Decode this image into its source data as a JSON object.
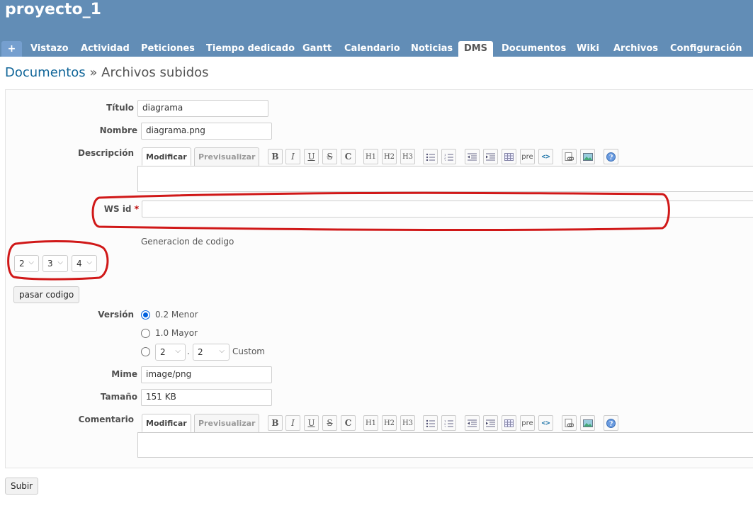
{
  "header": {
    "project_title": "proyecto_1",
    "plus_label": "+",
    "menu": [
      "Vistazo",
      "Actividad",
      "Peticiones",
      "Tiempo dedicado",
      "Gantt",
      "Calendario",
      "Noticias",
      "DMS",
      "Documentos",
      "Wiki",
      "Archivos",
      "Configuración"
    ],
    "selected": "DMS"
  },
  "breadcrumb": {
    "link": "Documentos",
    "separator": " » ",
    "current": "Archivos subidos"
  },
  "form": {
    "titulo_label": "Título",
    "titulo_value": "diagrama",
    "nombre_label": "Nombre",
    "nombre_value": "diagrama.png",
    "descripcion_label": "Descripción",
    "editor_tabs": {
      "edit": "Modificar",
      "preview": "Previsualizar"
    },
    "toolbar": [
      "B",
      "I",
      "U",
      "S",
      "C",
      "H1",
      "H2",
      "H3",
      "ul",
      "ol",
      "indent-left",
      "indent-right",
      "table",
      "pre",
      "<>",
      "link",
      "image",
      "help"
    ],
    "ws_id_label": "WS id",
    "ws_id_required": "*",
    "ws_id_value": "",
    "generacion_label": "Generacion de codigo",
    "code_selects": [
      "2",
      "3",
      "4"
    ],
    "pasar_codigo_label": "pasar codigo",
    "version_label": "Versión",
    "version_options": [
      "0.2 Menor",
      "1.0 Mayor"
    ],
    "version_selected": "0.2 Menor",
    "custom_major": "2",
    "custom_dot": ".",
    "custom_minor": "2",
    "custom_label": "Custom",
    "mime_label": "Mime",
    "mime_value": "image/png",
    "tamano_label": "Tamaño",
    "tamano_value": "151 KB",
    "comentario_label": "Comentario",
    "submit_label": "Subir"
  },
  "colors": {
    "header_bg": "#628db6",
    "link": "#116699",
    "annotation": "#d01818"
  }
}
